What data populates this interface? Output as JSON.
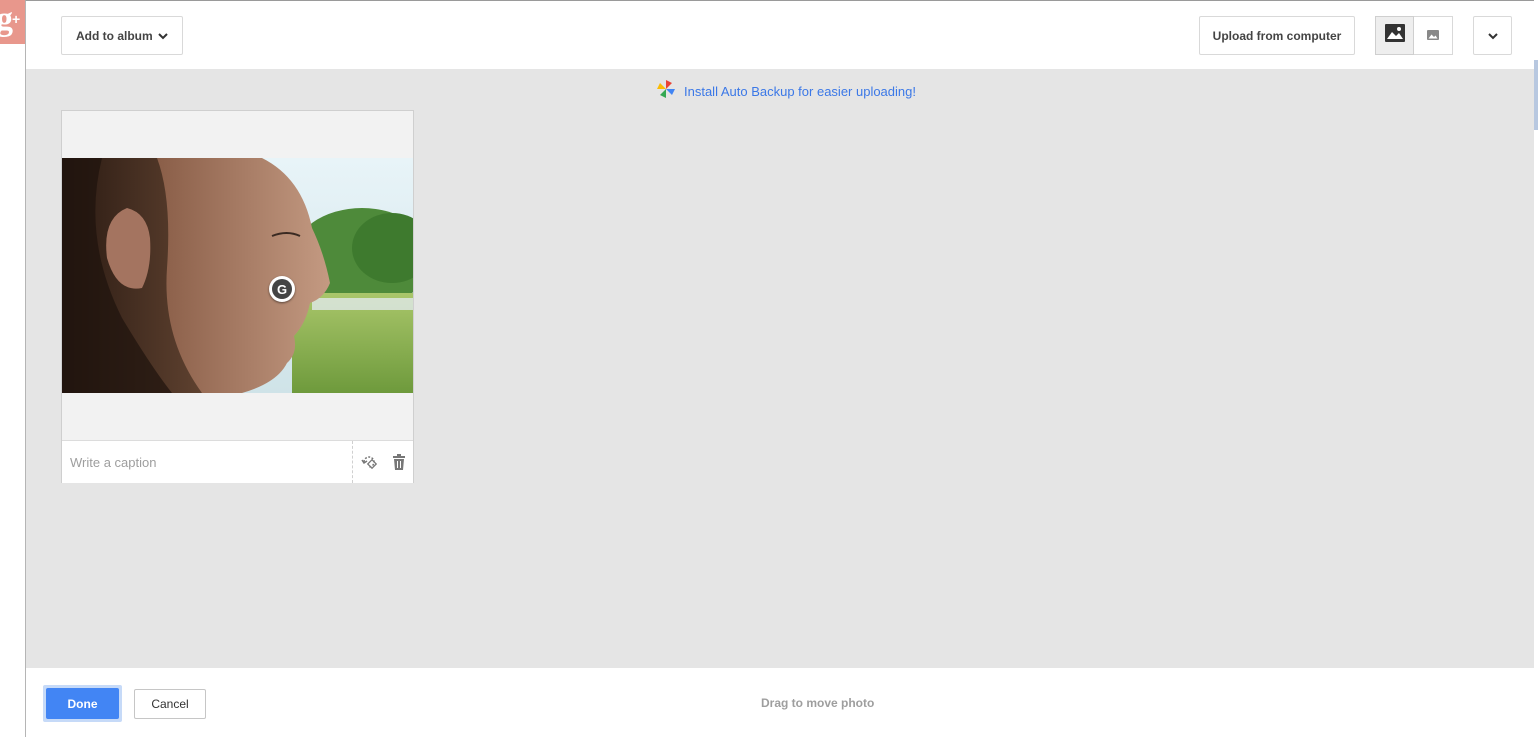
{
  "app": {
    "logo_text": "g+",
    "brand_color": "#dd4b39"
  },
  "header": {
    "album_button_label": "Add to album",
    "upload_button_label": "Upload from computer",
    "view_modes": [
      {
        "icon": "large-image-view-icon",
        "active": true
      },
      {
        "icon": "small-image-view-icon",
        "active": false
      }
    ],
    "more_icon": "chevron-down-icon"
  },
  "promo": {
    "icon": "pinwheel-icon",
    "link_text": "Install Auto Backup for easier uploading!"
  },
  "photos": [
    {
      "caption": "",
      "caption_placeholder": "Write a caption",
      "actions": [
        "rotate-icon",
        "trash-icon"
      ]
    }
  ],
  "footer": {
    "done_label": "Done",
    "cancel_label": "Cancel",
    "hint": "Drag to move photo"
  },
  "colors": {
    "accent": "#4285f4",
    "link": "#3b78e7",
    "canvas_bg": "#e5e5e5"
  }
}
